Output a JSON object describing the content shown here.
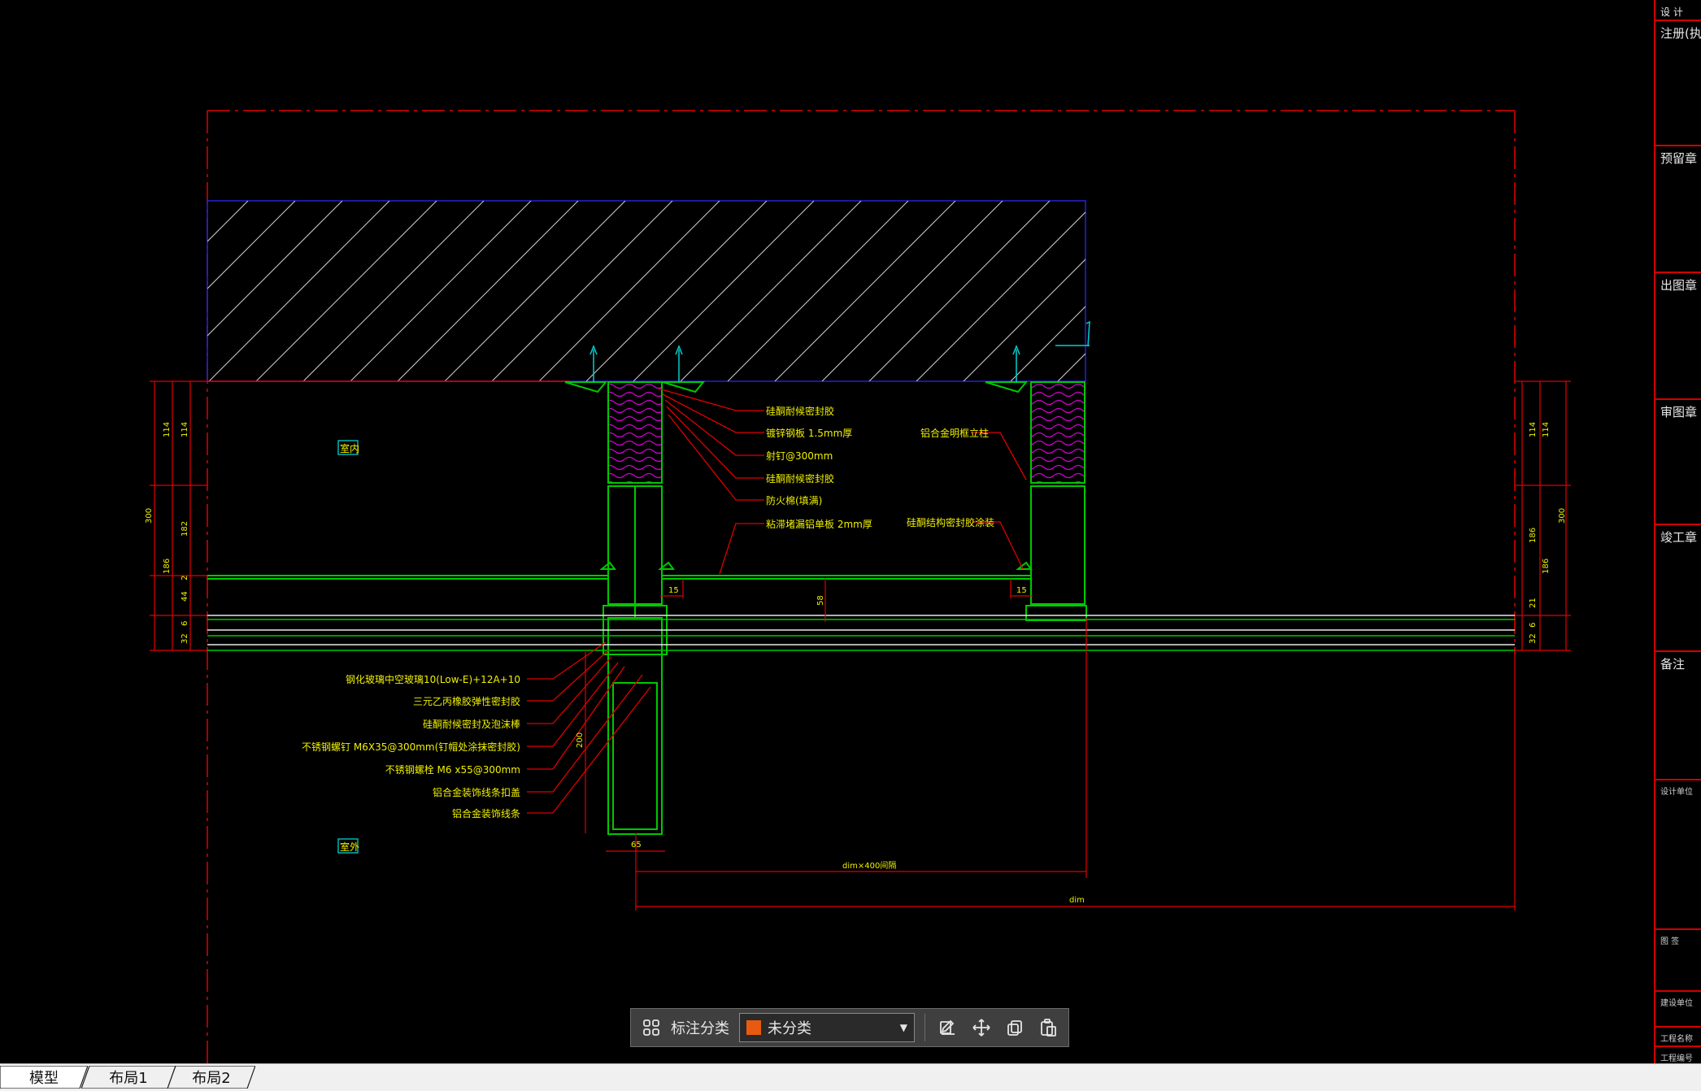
{
  "colors": {
    "background": "#000000",
    "red": "#e00000",
    "green": "#00c800",
    "blue": "#2323d6",
    "yellow": "#f0f000",
    "magenta": "#d000d0",
    "cyan": "#00d0d0",
    "white": "#e8e8e8",
    "swatch": "#e85a10"
  },
  "drawing": {
    "room_labels": {
      "indoor": "室内",
      "outdoor": "室外"
    },
    "callouts_right": [
      "硅酮耐候密封胶",
      "镀锌钢板 1.5mm厚",
      "射钉@300mm",
      "硅酮耐候密封胶",
      "防火棉(填满)",
      "粘滞堵漏铝单板 2mm厚"
    ],
    "callouts_far": [
      "铝合金明框立柱",
      "硅酮结构密封胶涂装"
    ],
    "callouts_left": [
      "钢化玻璃中空玻璃10(Low-E)+12A+10",
      "三元乙丙橡胶弹性密封胶",
      "硅酮耐候密封及泡沫棒",
      "不锈钢螺钉 M6X35@300mm(钉帽处涂抹密封胶)",
      "不锈钢螺栓 M6 x55@300mm",
      "铝合金装饰线条扣盖",
      "铝合金装饰线条"
    ],
    "dims_left_outer": [
      "300"
    ],
    "dims_left_mid": [
      "114",
      "182",
      "186",
      "2",
      "44",
      "6",
      "32"
    ],
    "dims_left_inner": [
      "114"
    ],
    "dims_right": [
      "114",
      "114",
      "186",
      "186",
      "300",
      "21",
      "6",
      "32"
    ],
    "dims_misc": {
      "d15a": "15",
      "d15b": "15",
      "d58": "58",
      "d200": "200",
      "d65": "65"
    },
    "dim_bottom_1": "dim×400间隔",
    "dim_bottom_2": "dim"
  },
  "title_block": {
    "cells": [
      "设 计",
      "注册(执业",
      "预留章",
      "出图章",
      "审图章",
      "竣工章",
      "备注",
      "设计单位",
      "图 签",
      "建设单位",
      "工程名称",
      "工程编号"
    ]
  },
  "toolbar": {
    "label": "标注分类",
    "selected": "未分类",
    "icons": [
      "grid-icon",
      "edit-icon",
      "move-icon",
      "copy-icon",
      "paste-icon"
    ]
  },
  "tabs": [
    {
      "label": "模型",
      "active": true
    },
    {
      "label": "布局1",
      "active": false
    },
    {
      "label": "布局2",
      "active": false
    }
  ]
}
